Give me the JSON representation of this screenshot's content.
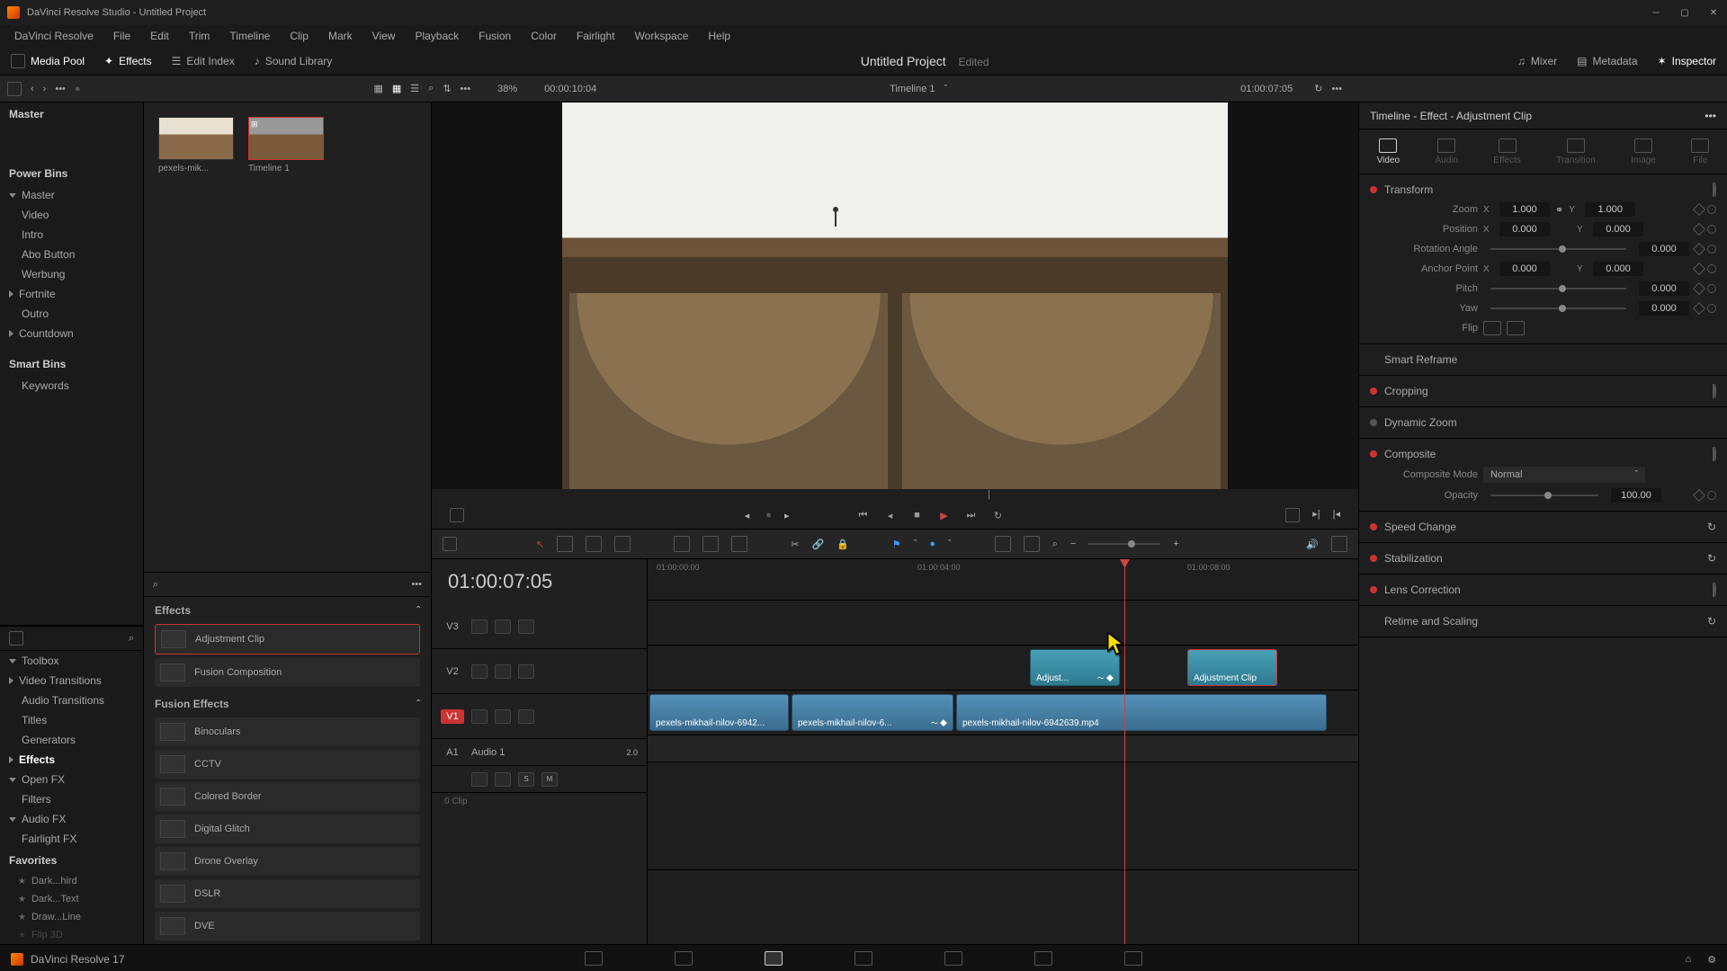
{
  "titlebar": {
    "text": "DaVinci Resolve Studio - Untitled Project"
  },
  "menubar": [
    "DaVinci Resolve",
    "File",
    "Edit",
    "Trim",
    "Timeline",
    "Clip",
    "Mark",
    "View",
    "Playback",
    "Fusion",
    "Color",
    "Fairlight",
    "Workspace",
    "Help"
  ],
  "topbar": {
    "media_pool": "Media Pool",
    "effects": "Effects",
    "edit_index": "Edit Index",
    "sound_library": "Sound Library",
    "project": "Untitled Project",
    "edited": "Edited",
    "mixer": "Mixer",
    "metadata": "Metadata",
    "inspector": "Inspector"
  },
  "toolbar2": {
    "zoom_pct": "38%",
    "tc_left": "00:00:10:04",
    "timeline_name": "Timeline 1",
    "tc_right": "01:00:07:05"
  },
  "bins": {
    "master": "Master",
    "power_bins": "Power Bins",
    "items": [
      "Master",
      "Video",
      "Intro",
      "Abo Button",
      "Werbung",
      "Fortnite",
      "Outro",
      "Countdown"
    ],
    "smart_bins": "Smart Bins",
    "keywords": "Keywords"
  },
  "media_thumbs": [
    {
      "label": "pexels-mik..."
    },
    {
      "label": "Timeline 1"
    }
  ],
  "toolbox": {
    "header": "Toolbox",
    "items": [
      "Video Transitions",
      "Audio Transitions",
      "Titles",
      "Generators",
      "Effects",
      "Open FX",
      "Filters",
      "Audio FX",
      "Fairlight FX"
    ],
    "favorites": "Favorites",
    "fav_items": [
      "Dark...hird",
      "Dark...Text",
      "Draw...Line",
      "Flip 3D"
    ]
  },
  "effects_panel": {
    "header": "Effects",
    "adjustment": "Adjustment Clip",
    "fusion_comp": "Fusion Composition",
    "fusion_header": "Fusion Effects",
    "list": [
      "Binoculars",
      "CCTV",
      "Colored Border",
      "Digital Glitch",
      "Drone Overlay",
      "DSLR",
      "DVE"
    ]
  },
  "timeline": {
    "tc": "01:00:07:05",
    "tracks": {
      "v3": "V3",
      "v2": "V2",
      "v1": "V1",
      "a1": "A1",
      "a1_name": "Audio 1",
      "a1_ch": "2.0",
      "a1_clip": "0 Clip"
    },
    "ruler": [
      "01:00:00:00",
      "01:00:04:00",
      "01:00:08:00"
    ],
    "ruler_pos": [
      10,
      300,
      600
    ],
    "clips": {
      "c1": "pexels-mikhail-nilov-6942...",
      "c2": "pexels-mikhail-nilov-6...",
      "c3": "pexels-mikhail-nilov-6942639.mp4",
      "adj1": "Adjust...",
      "adj2": "Adjustment Clip"
    }
  },
  "inspector": {
    "title": "Timeline - Effect - Adjustment Clip",
    "tabs": [
      "Video",
      "Audio",
      "Effects",
      "Transition",
      "Image",
      "File"
    ],
    "transform": "Transform",
    "zoom": "Zoom",
    "zoom_x": "1.000",
    "zoom_y": "1.000",
    "position": "Position",
    "pos_x": "0.000",
    "pos_y": "0.000",
    "rotation": "Rotation Angle",
    "rot_v": "0.000",
    "anchor": "Anchor Point",
    "anc_x": "0.000",
    "anc_y": "0.000",
    "pitch": "Pitch",
    "pitch_v": "0.000",
    "yaw": "Yaw",
    "yaw_v": "0.000",
    "flip": "Flip",
    "sections": [
      "Smart Reframe",
      "Cropping",
      "Dynamic Zoom",
      "Composite"
    ],
    "comp_mode_lbl": "Composite Mode",
    "comp_mode": "Normal",
    "opacity_lbl": "Opacity",
    "opacity": "100.00",
    "more": [
      "Speed Change",
      "Stabilization",
      "Lens Correction",
      "Retime and Scaling"
    ]
  },
  "footer": {
    "version": "DaVinci Resolve 17"
  },
  "audio_controls": {
    "s": "S",
    "m": "M"
  }
}
